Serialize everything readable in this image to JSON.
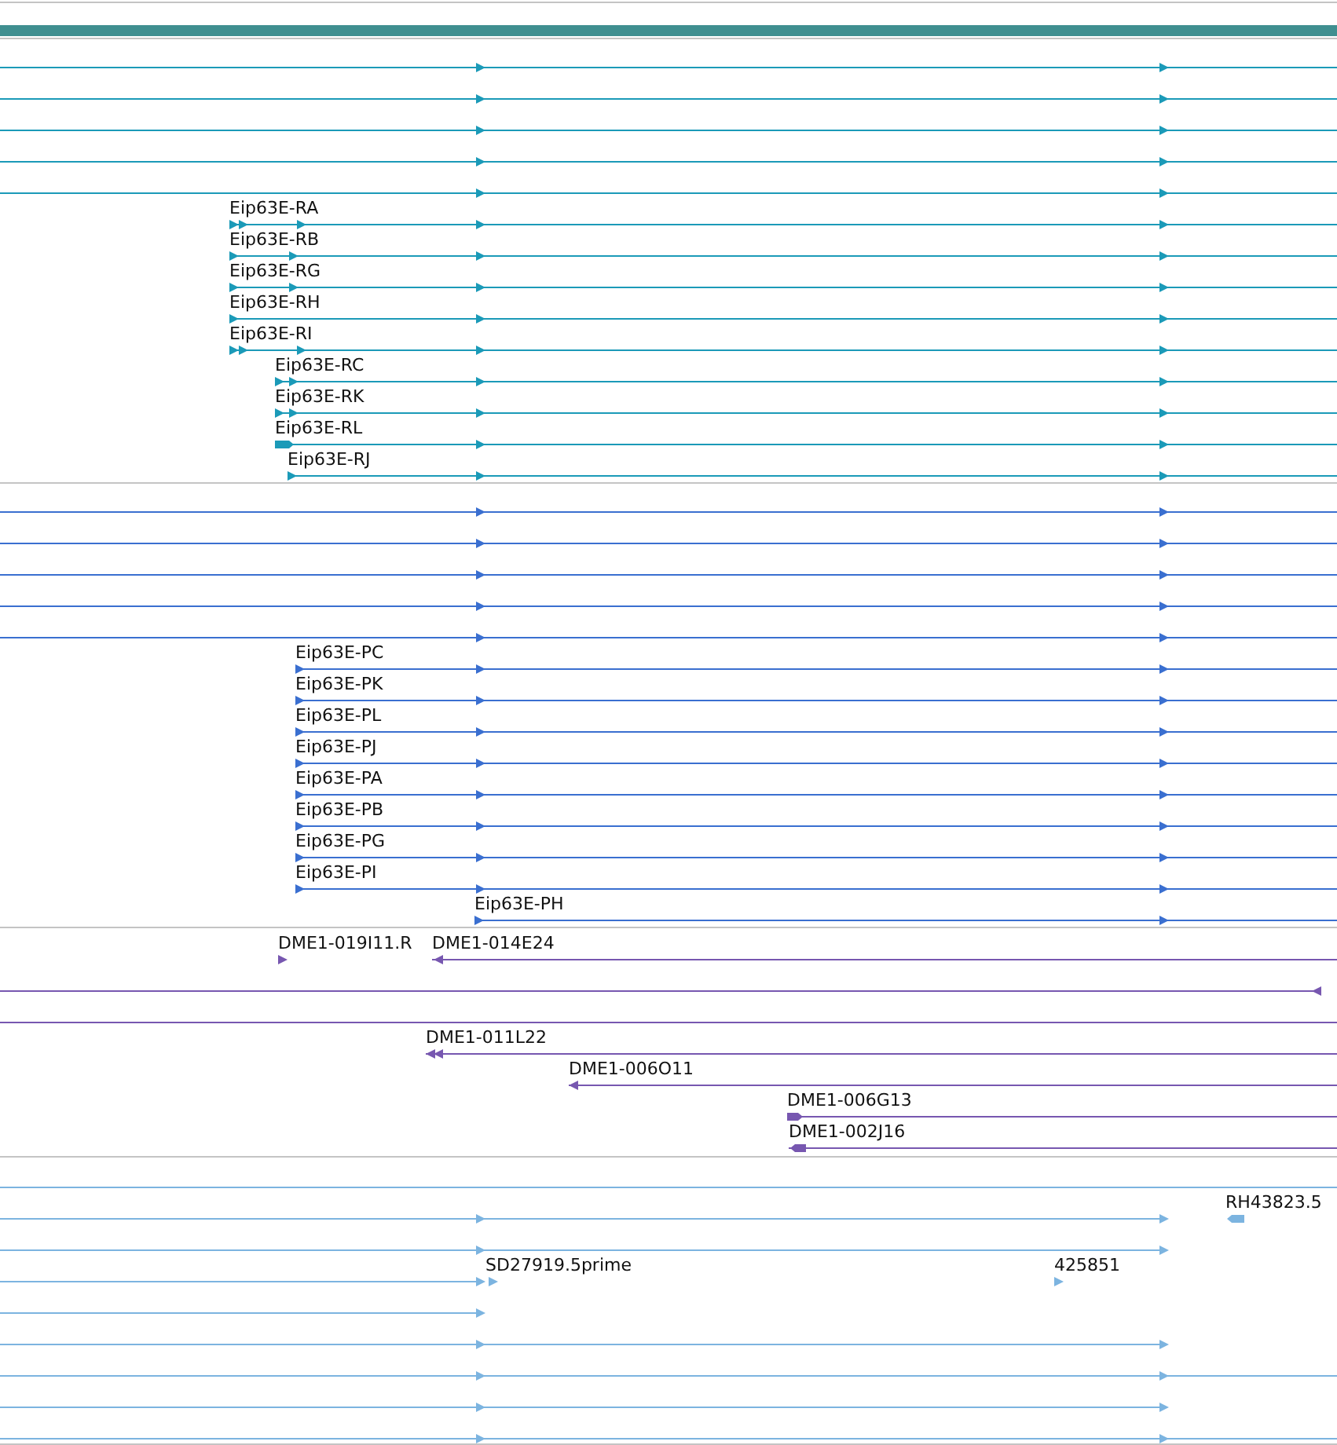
{
  "tracks": [
    {
      "color": "#1b9ab8",
      "labels": [
        "Eip63E-RA",
        "Eip63E-RB",
        "Eip63E-RG",
        "Eip63E-RH",
        "Eip63E-RI",
        "Eip63E-RC",
        "Eip63E-RK",
        "Eip63E-RL",
        "Eip63E-RJ"
      ]
    },
    {
      "color": "#3a6fd0",
      "labels": [
        "Eip63E-PC",
        "Eip63E-PK",
        "Eip63E-PL",
        "Eip63E-PJ",
        "Eip63E-PA",
        "Eip63E-PB",
        "Eip63E-PG",
        "Eip63E-PI",
        "Eip63E-PH"
      ]
    },
    {
      "color": "#7757b0",
      "labels": [
        "DME1-019I11.R",
        "DME1-014E24",
        "DME1-011L22",
        "DME1-006O11",
        "DME1-006G13",
        "DME1-002J16"
      ]
    },
    {
      "color": "#7cb4e0",
      "labels": [
        "RH43823.5",
        "SD27919.5prime",
        "425851"
      ]
    }
  ]
}
